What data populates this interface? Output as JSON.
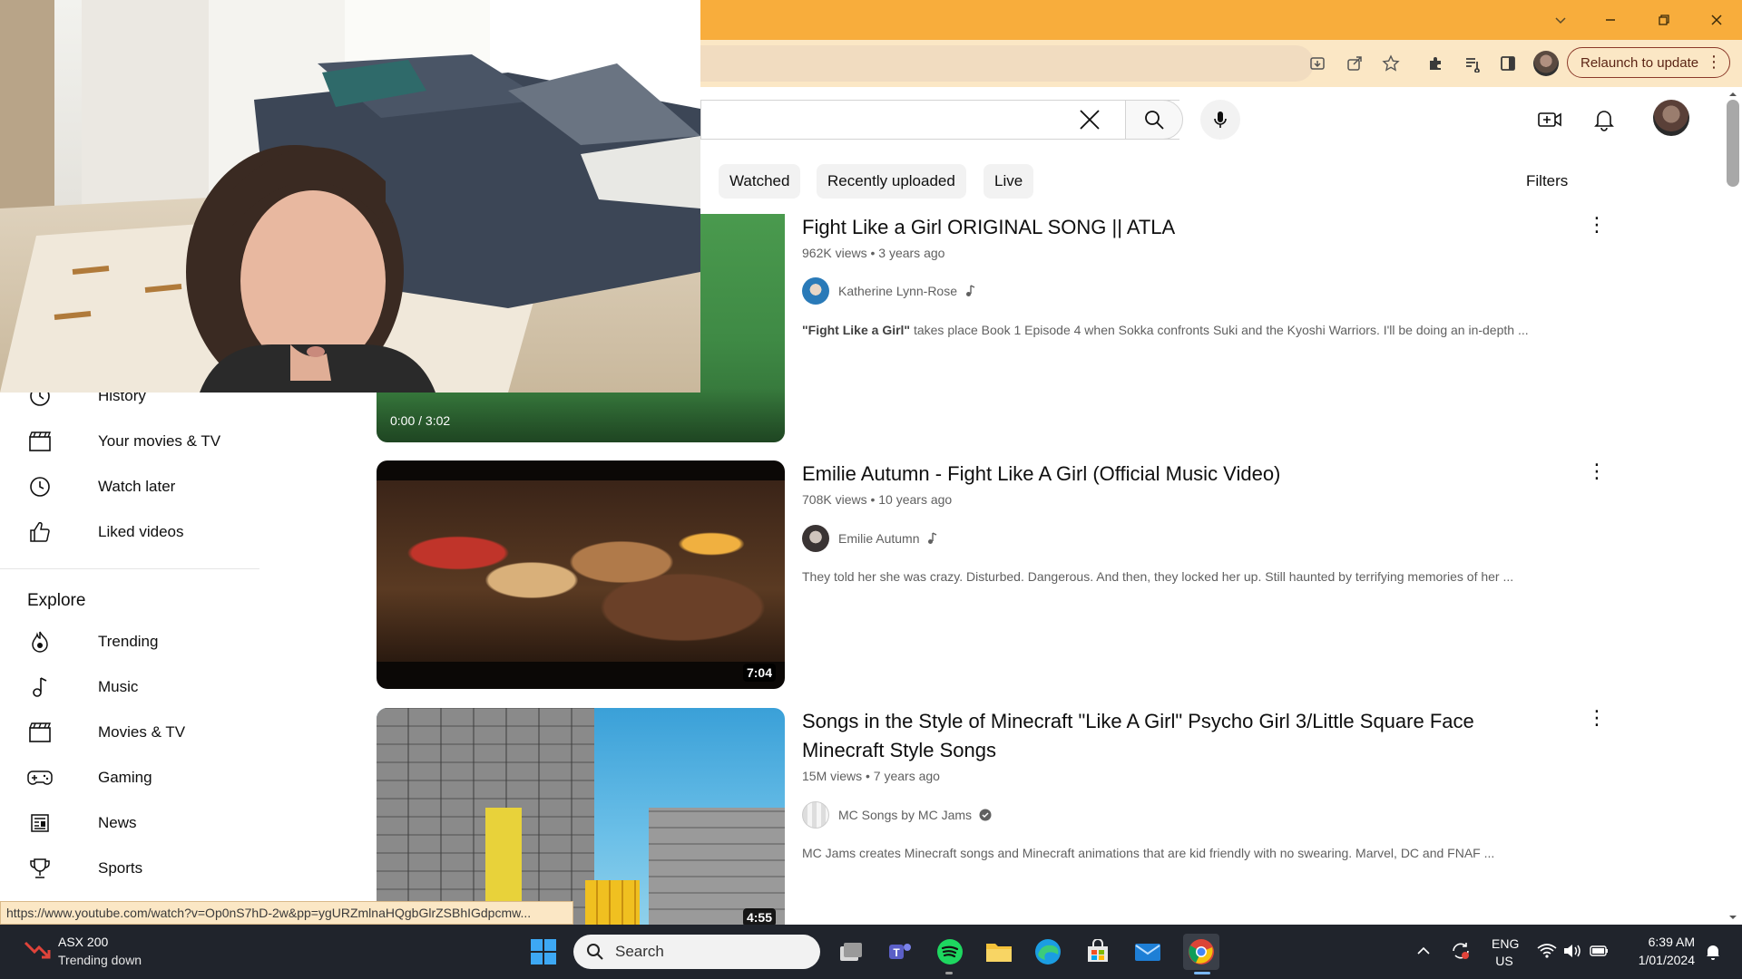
{
  "browser": {
    "relaunch_label": "Relaunch to update",
    "status_url": "https://www.youtube.com/watch?v=Op0nS7hD-2w&pp=ygURZmlnaHQgbGlrZSBhIGdpcmw..."
  },
  "chips": [
    "Watched",
    "Recently uploaded",
    "Live"
  ],
  "filters_label": "Filters",
  "sidebar": {
    "items_top": [
      {
        "label": "History",
        "icon": "history-icon"
      },
      {
        "label": "Your movies & TV",
        "icon": "clapperboard-icon"
      },
      {
        "label": "Watch later",
        "icon": "clock-icon"
      },
      {
        "label": "Liked videos",
        "icon": "thumbs-up-icon"
      }
    ],
    "explore_title": "Explore",
    "explore_items": [
      {
        "label": "Trending",
        "icon": "trending-icon"
      },
      {
        "label": "Music",
        "icon": "music-note-icon"
      },
      {
        "label": "Movies & TV",
        "icon": "clapperboard-icon"
      },
      {
        "label": "Gaming",
        "icon": "gamepad-icon"
      },
      {
        "label": "News",
        "icon": "news-icon"
      },
      {
        "label": "Sports",
        "icon": "trophy-icon"
      }
    ]
  },
  "videos": [
    {
      "title": "Fight Like a Girl ORIGINAL SONG || ATLA",
      "meta": "962K views • 3 years ago",
      "channel": "Katherine Lynn-Rose",
      "channel_badge": "music-note-icon",
      "description_bold": "\"Fight Like a Girl\"",
      "description_rest": " takes place Book 1 Episode 4 when Sokka confronts Suki and the Kyoshi Warriors. I'll be doing an in-depth ...",
      "progress_time": "0:00 / 3:02"
    },
    {
      "title": "Emilie Autumn - Fight Like A Girl (Official Music Video)",
      "meta": "708K views • 10 years ago",
      "channel": "Emilie Autumn",
      "channel_badge": "music-note-icon",
      "description_rest": "They told her she was crazy. Disturbed. Dangerous. And then, they locked her up. Still haunted by terrifying memories of her ...",
      "duration": "7:04"
    },
    {
      "title": "Songs in the Style of Minecraft \"Like A Girl\" Psycho Girl 3/Little Square Face Minecraft Style Songs",
      "meta": "15M views • 7 years ago",
      "channel": "MC Songs by MC Jams",
      "channel_badge": "verified-icon",
      "description_rest": "MC Jams creates Minecraft songs and Minecraft animations that are kid friendly with no swearing. Marvel, DC and FNAF ...",
      "duration": "4:55"
    }
  ],
  "taskbar": {
    "stock_name": "ASX 200",
    "stock_status": "Trending down",
    "search_placeholder": "Search",
    "lang_top": "ENG",
    "lang_bottom": "US",
    "time": "6:39 AM",
    "date": "1/01/2024"
  }
}
